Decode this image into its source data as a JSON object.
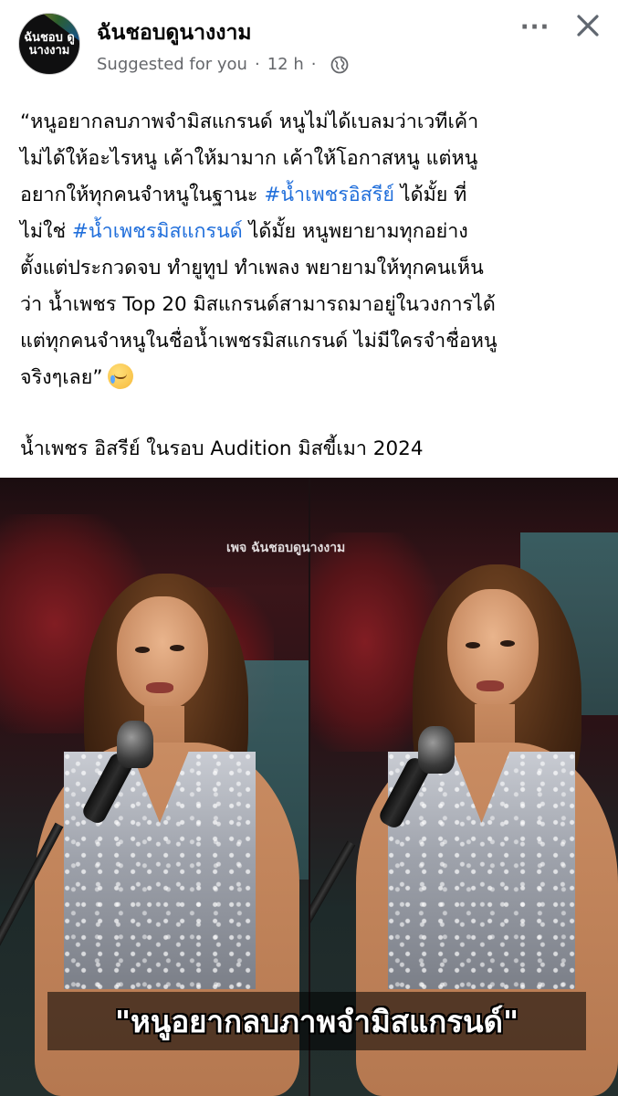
{
  "header": {
    "page_name": "ฉันชอบดูนางงาม",
    "suggested": "Suggested for you",
    "separator": "·",
    "time": "12 h",
    "avatar_text": "ฉันชอบ ดูนางงาม",
    "more_label": "···",
    "icons": {
      "privacy": "globe-icon",
      "close": "close-icon",
      "more": "more-options-icon"
    }
  },
  "post": {
    "lines": [
      "“หนูอยากลบภาพจำมิสแกรนด์ หนูไม่ได้เบลมว่าเวทีเค้า",
      "ไม่ได้ให้อะไรหนู เค้าให้มามาก เค้าให้โอกาสหนู แต่หนู",
      "อยากให้ทุกคนจำหนูในฐานะ",
      "ได้มั้ย ที่",
      "ไม่ใช่",
      "ได้มั้ย หนูพยายามทุกอย่าง",
      "ตั้งแต่ประกวดจบ ทำยูทูป ทำเพลง พยายามให้ทุกคนเห็น",
      "ว่า น้ำเพชร Top 20 มิสแกรนด์สามารถมาอยู่ในวงการได้",
      "แต่ทุกคนจำหนูในชื่อน้ำเพชรมิสแกรนด์ ไม่มีใครจำชื่อหนู",
      "จริงๆเลย”"
    ],
    "hashtag_1": "#น้ำเพชรอิสรีย์",
    "hashtag_2": "#น้ำเพชรมิสแกรนด์",
    "emoji": "smiling-face-with-tear",
    "caption": "น้ำเพชร อิสรีย์ ในรอบ Audition มิสขี้เมา 2024"
  },
  "photo": {
    "watermark": "เพจ ฉันชอบดูนางงาม",
    "subtitle": "\"หนูอยากลบภาพจำมิสแกรนด์\""
  },
  "colors": {
    "hashtag": "#216fdb",
    "meta": "#65676b",
    "text": "#050505"
  }
}
